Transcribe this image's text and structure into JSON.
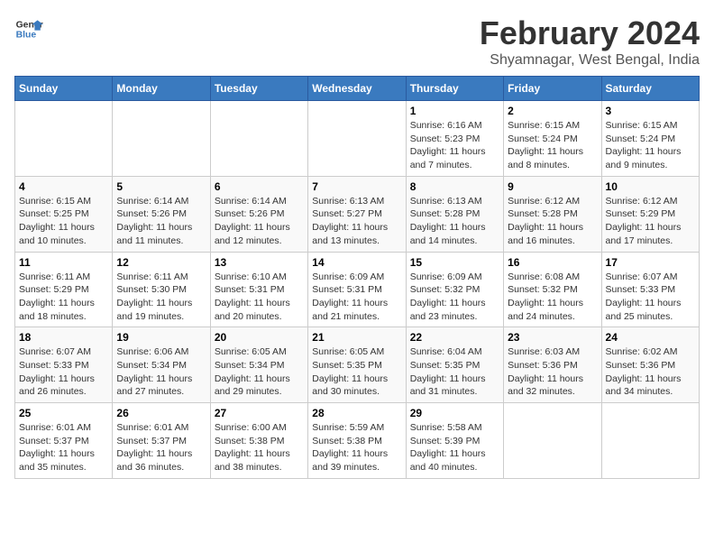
{
  "logo": {
    "general": "General",
    "blue": "Blue"
  },
  "title": "February 2024",
  "subtitle": "Shyamnagar, West Bengal, India",
  "days_header": [
    "Sunday",
    "Monday",
    "Tuesday",
    "Wednesday",
    "Thursday",
    "Friday",
    "Saturday"
  ],
  "weeks": [
    [
      {
        "num": "",
        "info": ""
      },
      {
        "num": "",
        "info": ""
      },
      {
        "num": "",
        "info": ""
      },
      {
        "num": "",
        "info": ""
      },
      {
        "num": "1",
        "info": "Sunrise: 6:16 AM\nSunset: 5:23 PM\nDaylight: 11 hours\nand 7 minutes."
      },
      {
        "num": "2",
        "info": "Sunrise: 6:15 AM\nSunset: 5:24 PM\nDaylight: 11 hours\nand 8 minutes."
      },
      {
        "num": "3",
        "info": "Sunrise: 6:15 AM\nSunset: 5:24 PM\nDaylight: 11 hours\nand 9 minutes."
      }
    ],
    [
      {
        "num": "4",
        "info": "Sunrise: 6:15 AM\nSunset: 5:25 PM\nDaylight: 11 hours\nand 10 minutes."
      },
      {
        "num": "5",
        "info": "Sunrise: 6:14 AM\nSunset: 5:26 PM\nDaylight: 11 hours\nand 11 minutes."
      },
      {
        "num": "6",
        "info": "Sunrise: 6:14 AM\nSunset: 5:26 PM\nDaylight: 11 hours\nand 12 minutes."
      },
      {
        "num": "7",
        "info": "Sunrise: 6:13 AM\nSunset: 5:27 PM\nDaylight: 11 hours\nand 13 minutes."
      },
      {
        "num": "8",
        "info": "Sunrise: 6:13 AM\nSunset: 5:28 PM\nDaylight: 11 hours\nand 14 minutes."
      },
      {
        "num": "9",
        "info": "Sunrise: 6:12 AM\nSunset: 5:28 PM\nDaylight: 11 hours\nand 16 minutes."
      },
      {
        "num": "10",
        "info": "Sunrise: 6:12 AM\nSunset: 5:29 PM\nDaylight: 11 hours\nand 17 minutes."
      }
    ],
    [
      {
        "num": "11",
        "info": "Sunrise: 6:11 AM\nSunset: 5:29 PM\nDaylight: 11 hours\nand 18 minutes."
      },
      {
        "num": "12",
        "info": "Sunrise: 6:11 AM\nSunset: 5:30 PM\nDaylight: 11 hours\nand 19 minutes."
      },
      {
        "num": "13",
        "info": "Sunrise: 6:10 AM\nSunset: 5:31 PM\nDaylight: 11 hours\nand 20 minutes."
      },
      {
        "num": "14",
        "info": "Sunrise: 6:09 AM\nSunset: 5:31 PM\nDaylight: 11 hours\nand 21 minutes."
      },
      {
        "num": "15",
        "info": "Sunrise: 6:09 AM\nSunset: 5:32 PM\nDaylight: 11 hours\nand 23 minutes."
      },
      {
        "num": "16",
        "info": "Sunrise: 6:08 AM\nSunset: 5:32 PM\nDaylight: 11 hours\nand 24 minutes."
      },
      {
        "num": "17",
        "info": "Sunrise: 6:07 AM\nSunset: 5:33 PM\nDaylight: 11 hours\nand 25 minutes."
      }
    ],
    [
      {
        "num": "18",
        "info": "Sunrise: 6:07 AM\nSunset: 5:33 PM\nDaylight: 11 hours\nand 26 minutes."
      },
      {
        "num": "19",
        "info": "Sunrise: 6:06 AM\nSunset: 5:34 PM\nDaylight: 11 hours\nand 27 minutes."
      },
      {
        "num": "20",
        "info": "Sunrise: 6:05 AM\nSunset: 5:34 PM\nDaylight: 11 hours\nand 29 minutes."
      },
      {
        "num": "21",
        "info": "Sunrise: 6:05 AM\nSunset: 5:35 PM\nDaylight: 11 hours\nand 30 minutes."
      },
      {
        "num": "22",
        "info": "Sunrise: 6:04 AM\nSunset: 5:35 PM\nDaylight: 11 hours\nand 31 minutes."
      },
      {
        "num": "23",
        "info": "Sunrise: 6:03 AM\nSunset: 5:36 PM\nDaylight: 11 hours\nand 32 minutes."
      },
      {
        "num": "24",
        "info": "Sunrise: 6:02 AM\nSunset: 5:36 PM\nDaylight: 11 hours\nand 34 minutes."
      }
    ],
    [
      {
        "num": "25",
        "info": "Sunrise: 6:01 AM\nSunset: 5:37 PM\nDaylight: 11 hours\nand 35 minutes."
      },
      {
        "num": "26",
        "info": "Sunrise: 6:01 AM\nSunset: 5:37 PM\nDaylight: 11 hours\nand 36 minutes."
      },
      {
        "num": "27",
        "info": "Sunrise: 6:00 AM\nSunset: 5:38 PM\nDaylight: 11 hours\nand 38 minutes."
      },
      {
        "num": "28",
        "info": "Sunrise: 5:59 AM\nSunset: 5:38 PM\nDaylight: 11 hours\nand 39 minutes."
      },
      {
        "num": "29",
        "info": "Sunrise: 5:58 AM\nSunset: 5:39 PM\nDaylight: 11 hours\nand 40 minutes."
      },
      {
        "num": "",
        "info": ""
      },
      {
        "num": "",
        "info": ""
      }
    ]
  ]
}
